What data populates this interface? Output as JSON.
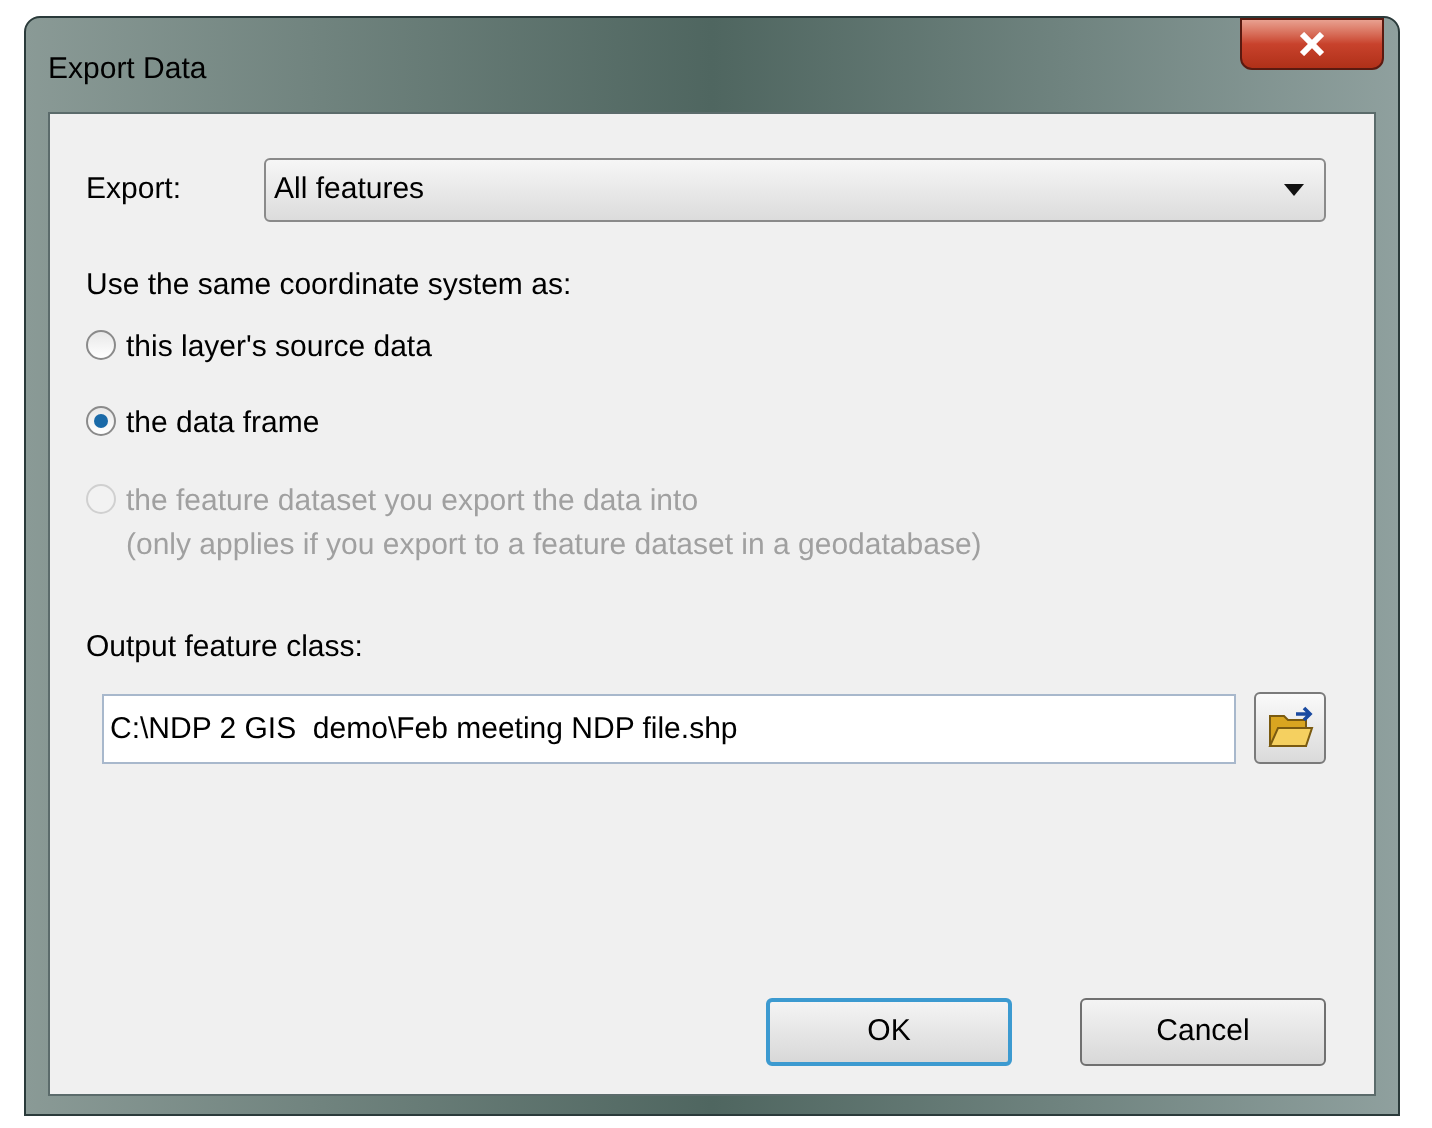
{
  "window": {
    "title": "Export Data"
  },
  "export": {
    "label": "Export:",
    "value": "All features"
  },
  "coordinate_system": {
    "label": "Use the same coordinate system as:",
    "options": [
      {
        "label": "this layer's source data",
        "selected": false,
        "disabled": false
      },
      {
        "label": "the data frame",
        "selected": true,
        "disabled": false
      },
      {
        "label": "the feature dataset you export the data into",
        "note": "(only applies if you export to a feature dataset in a geodatabase)",
        "selected": false,
        "disabled": true
      }
    ]
  },
  "output": {
    "label": "Output feature class:",
    "value": "C:\\NDP 2 GIS  demo\\Feb meeting NDP file.shp"
  },
  "buttons": [
    {
      "label": "OK",
      "default": true
    },
    {
      "label": "Cancel",
      "default": false
    }
  ]
}
